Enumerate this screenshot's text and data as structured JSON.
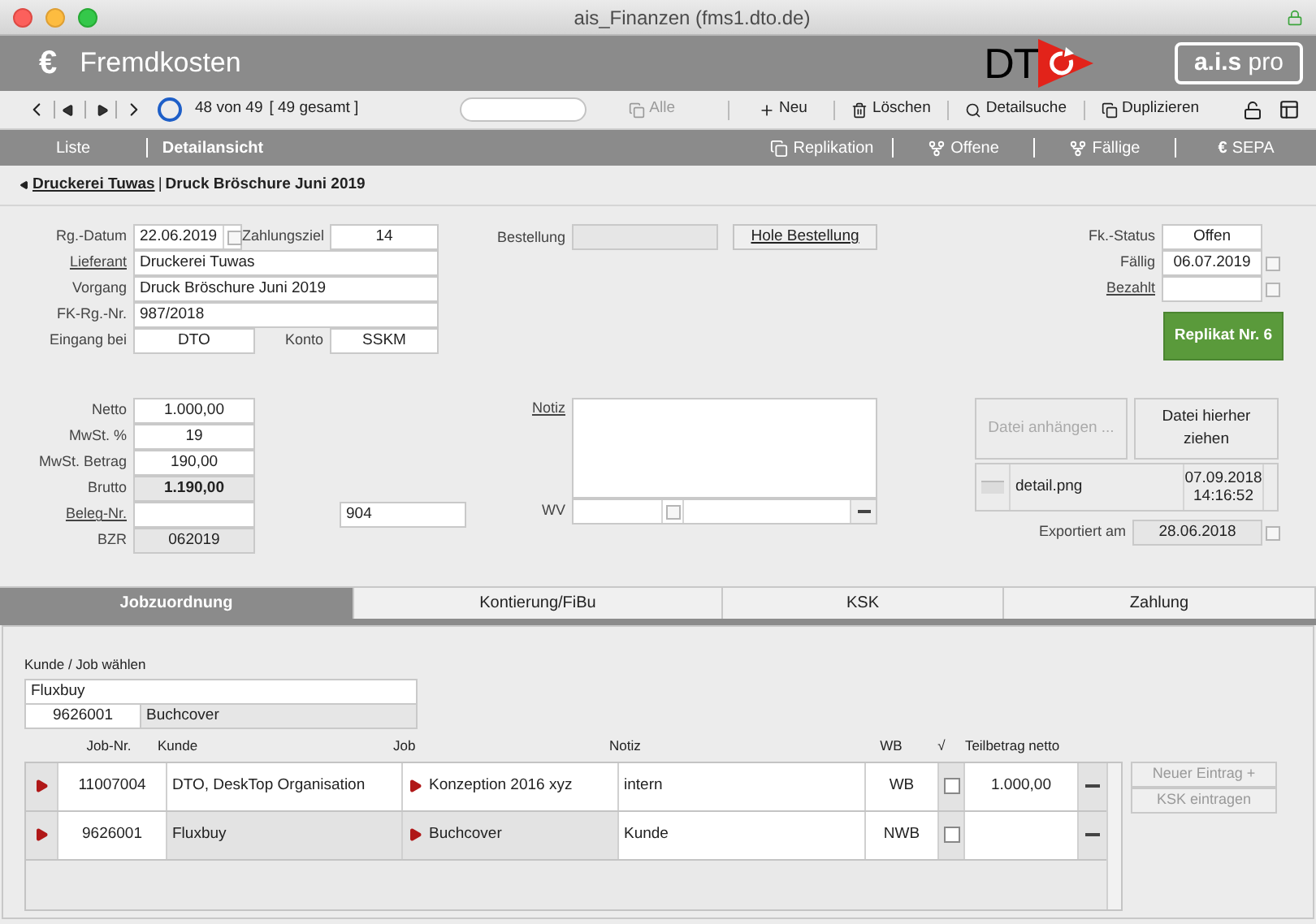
{
  "window": {
    "title": "ais_Finanzen (fms1.dto.de)"
  },
  "header": {
    "icon": "€",
    "title": "Fremdkosten",
    "logo": "DT",
    "product": "**a.i.s** pro"
  },
  "toolbar": {
    "record_info": "48 von 49",
    "total": "[ 49 gesamt ]",
    "actions": [
      {
        "kind": "all",
        "label": "Alle",
        "disabled": true
      },
      {
        "kind": "new",
        "label": "Neu",
        "disabled": false
      },
      {
        "kind": "delete",
        "label": "Löschen",
        "disabled": false
      },
      {
        "kind": "search",
        "label": "Detailsuche",
        "disabled": false
      },
      {
        "kind": "duplicate",
        "label": "Duplizieren",
        "disabled": false
      }
    ]
  },
  "nav": {
    "tabs": [
      {
        "label": "Liste",
        "selected": false
      },
      {
        "label": "Detailansicht",
        "selected": true
      }
    ],
    "actions": [
      {
        "kind": "replicate",
        "label": "Replikation"
      },
      {
        "kind": "filter",
        "label": "Offene"
      },
      {
        "kind": "filter",
        "label": "Fällige"
      },
      {
        "kind": "currency",
        "symbol": "€",
        "label": "SEPA"
      }
    ]
  },
  "breadcrumb": {
    "link": "Druckerei Tuwas",
    "separator": "|",
    "current": "Druck Bröschure Juni 2019"
  },
  "invoice": {
    "rg_datum": {
      "label": "Rg.-Datum",
      "value": "22.06.2019"
    },
    "zahlungsziel": {
      "label": "Zahlungsziel",
      "value": "14"
    },
    "lieferant": {
      "label": "Lieferant",
      "value": "Druckerei Tuwas",
      "link": true
    },
    "vorgang": {
      "label": "Vorgang",
      "value": "Druck Bröschure Juni 2019"
    },
    "fk_rg_nr": {
      "label": "FK-Rg.-Nr.",
      "value": "987/2018"
    },
    "eingang": {
      "label": "Eingang bei",
      "value": "DTO"
    },
    "konto": {
      "label": "Konto",
      "value": "SSKM"
    },
    "bestellung": {
      "label": "Bestellung",
      "button": "Hole Bestellung"
    },
    "fk_status": {
      "label": "Fk.-Status",
      "value": "Offen"
    },
    "faellig": {
      "label": "Fällig",
      "value": "06.07.2019"
    },
    "bezahlt": {
      "label": "Bezahlt",
      "link": true
    },
    "replikat_button": "Replikat Nr. 6"
  },
  "amounts": [
    {
      "label": "Netto",
      "value": "1.000,00",
      "readonly": false,
      "bold": false,
      "link": false
    },
    {
      "label": "MwSt. %",
      "value": "19",
      "readonly": false,
      "bold": false,
      "link": false
    },
    {
      "label": "MwSt. Betrag",
      "value": "190,00",
      "readonly": false,
      "bold": false,
      "link": false
    },
    {
      "label": "Brutto",
      "value": "1.190,00",
      "readonly": true,
      "bold": true,
      "link": false
    },
    {
      "label": "Beleg-Nr.",
      "readonly": false,
      "bold": false,
      "link": true,
      "extra": "904"
    },
    {
      "label": "BZR",
      "value": "062019",
      "readonly": true,
      "bold": false,
      "link": false
    }
  ],
  "notiz": {
    "label": "Notiz",
    "link": true,
    "wv_label": "WV"
  },
  "attachments": {
    "attach_button": "Datei anhängen ...",
    "attach_disabled": true,
    "drop_button": "Datei hierher ziehen",
    "file": {
      "name": "detail.png",
      "date": "07.09.2018",
      "time": "14:16:52"
    },
    "exported_label": "Exportiert am",
    "exported_value": "28.06.2018"
  },
  "tabs": [
    {
      "label": "Jobzuordnung",
      "selected": true
    },
    {
      "label": "Kontierung/FiBu",
      "selected": false
    },
    {
      "label": "KSK",
      "selected": false
    },
    {
      "label": "Zahlung",
      "selected": false
    }
  ],
  "job_picker": {
    "label": "Kunde / Job wählen",
    "kunde": "Fluxbuy",
    "job_nr": "9626001",
    "job": "Buchcover"
  },
  "job_table": {
    "columns": [
      "Job-Nr.",
      "Kunde",
      "Job",
      "Notiz",
      "WB",
      "√",
      "Teilbetrag netto"
    ],
    "rows": [
      {
        "job_nr": "11007004",
        "kunde": "DTO, DeskTop Organisation",
        "job": "Konzeption 2016 xyz",
        "notiz": "intern",
        "wb": "WB",
        "checked": false,
        "teilbetrag": "1.000,00",
        "selected": false
      },
      {
        "job_nr": "9626001",
        "kunde": "Fluxbuy",
        "job": "Buchcover",
        "notiz": "Kunde",
        "wb": "NWB",
        "checked": false,
        "selected": true
      }
    ]
  },
  "side_buttons": [
    {
      "label": "Neuer Eintrag +",
      "disabled": true
    },
    {
      "label": "KSK eintragen",
      "disabled": true
    }
  ]
}
